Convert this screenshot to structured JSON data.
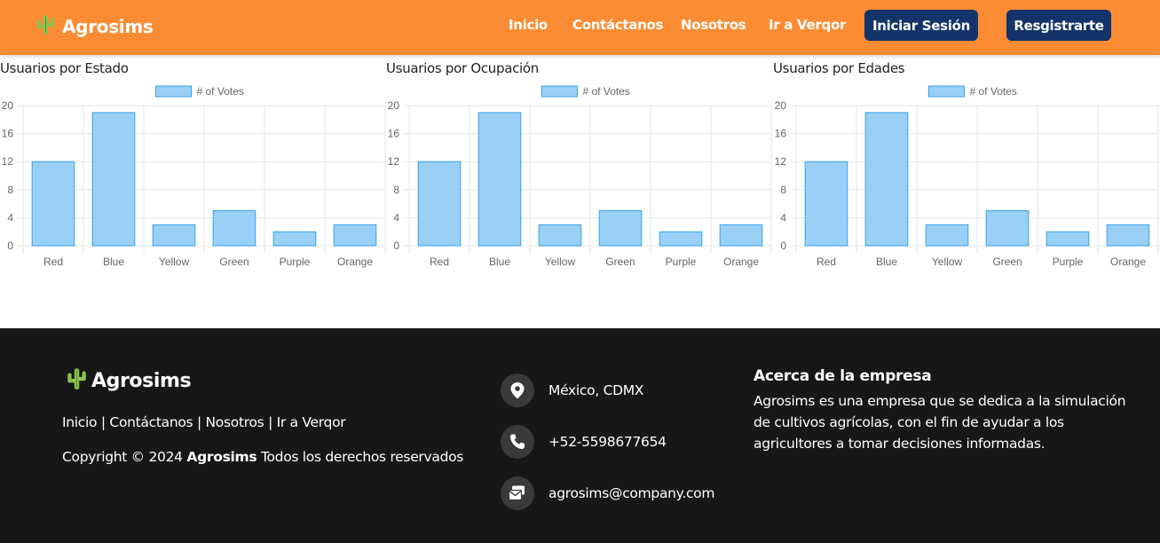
{
  "header": {
    "brand": "Agrosims",
    "nav": [
      "Inicio",
      "Contáctanos",
      "Nosotros",
      "Ir a Verqor"
    ],
    "login_label": "Iniciar Sesión",
    "register_label": "Resgistrarte"
  },
  "chart_data": [
    {
      "type": "bar",
      "title": "Usuarios por Estado",
      "categories": [
        "Red",
        "Blue",
        "Yellow",
        "Green",
        "Purple",
        "Orange"
      ],
      "series": [
        {
          "name": "# of Votes",
          "values": [
            12,
            19,
            3,
            5,
            2,
            3
          ]
        }
      ],
      "ylim": [
        0,
        20
      ],
      "yticks": [
        0,
        4,
        8,
        12,
        16,
        20
      ],
      "legend": "top-center",
      "grid": true
    },
    {
      "type": "bar",
      "title": "Usuarios por Ocupación",
      "categories": [
        "Red",
        "Blue",
        "Yellow",
        "Green",
        "Purple",
        "Orange"
      ],
      "series": [
        {
          "name": "# of Votes",
          "values": [
            12,
            19,
            3,
            5,
            2,
            3
          ]
        }
      ],
      "ylim": [
        0,
        20
      ],
      "yticks": [
        0,
        4,
        8,
        12,
        16,
        20
      ],
      "legend": "top-center",
      "grid": true
    },
    {
      "type": "bar",
      "title": "Usuarios por Edades",
      "categories": [
        "Red",
        "Blue",
        "Yellow",
        "Green",
        "Purple",
        "Orange"
      ],
      "series": [
        {
          "name": "# of Votes",
          "values": [
            12,
            19,
            3,
            5,
            2,
            3
          ]
        }
      ],
      "ylim": [
        0,
        20
      ],
      "yticks": [
        0,
        4,
        8,
        12,
        16,
        20
      ],
      "legend": "top-center",
      "grid": true
    }
  ],
  "footer": {
    "brand": "Agrosims",
    "links": [
      "Inicio",
      "Contáctanos",
      "Nosotros",
      "Ir a Verqor"
    ],
    "copyright_prefix": "Copyright © 2024",
    "copyright_brand": "Agrosims",
    "copyright_suffix": "Todos los derechos reservados",
    "contact": {
      "location": "México, CDMX",
      "phone": "+52-5598677654",
      "email": "agrosims@company.com"
    },
    "about_title": "Acerca de la empresa",
    "about_text": "Agrosims es una empresa que se dedica a la simulación de cultivos agrícolas, con el fin de ayudar a los agricultores a tomar decisiones informadas."
  },
  "colors": {
    "header_bg": "#fc8c34",
    "button_bg": "#13336a",
    "footer_bg": "#171717",
    "bar_fill": "#9ad0f5",
    "bar_stroke": "#36a2eb",
    "cactus": "#8bc34a"
  },
  "icons": {
    "brand": "cactus-icon",
    "location": "map-pin-icon",
    "phone": "phone-icon",
    "email": "envelope-icon"
  }
}
